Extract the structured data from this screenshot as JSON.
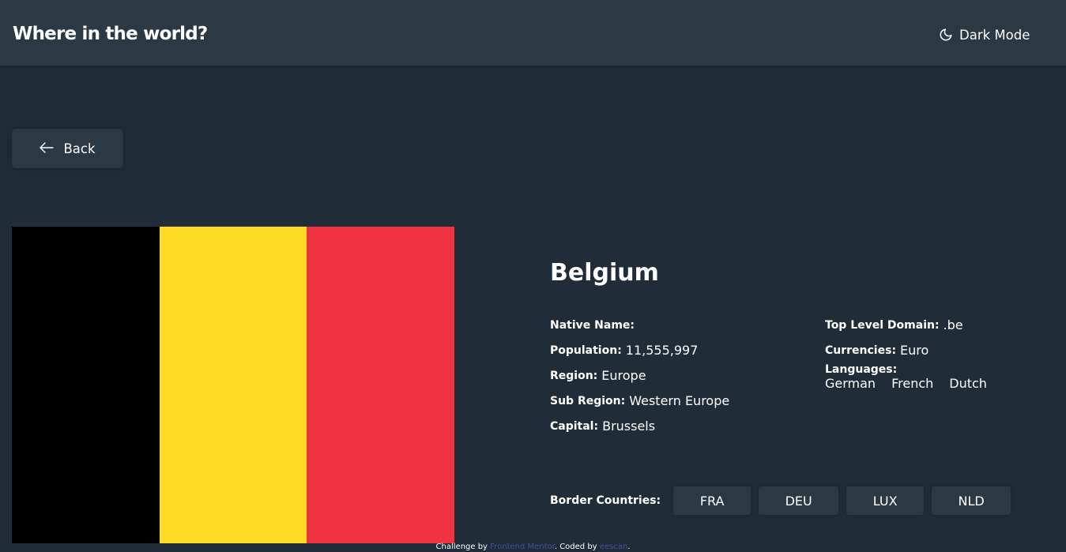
{
  "header": {
    "title": "Where in the world?",
    "theme_toggle_label": "Dark Mode",
    "theme_icon": "moon-icon"
  },
  "back_button": {
    "label": "Back",
    "icon": "arrow-left-icon"
  },
  "flag": {
    "country": "Belgium",
    "stripe_colors": [
      "#000000",
      "#fdda24",
      "#ef3340"
    ]
  },
  "country": {
    "name": "Belgium",
    "native_name_label": "Native Name:",
    "native_name_value": "",
    "population_label": "Population:",
    "population_value": "11,555,997",
    "region_label": "Region:",
    "region_value": "Europe",
    "sub_region_label": "Sub Region:",
    "sub_region_value": "Western Europe",
    "capital_label": "Capital:",
    "capital_value": "Brussels",
    "tld_label": "Top Level Domain:",
    "tld_value": ".be",
    "currencies_label": "Currencies:",
    "currencies_value": "Euro",
    "languages_label": "Languages:",
    "languages": [
      "German",
      "French",
      "Dutch"
    ]
  },
  "borders": {
    "label": "Border Countries:",
    "countries": [
      "FRA",
      "DEU",
      "LUX",
      "NLD"
    ]
  },
  "footer": {
    "prefix": "Challenge by",
    "link1": "Frontend Mentor",
    "middle": ". Coded by",
    "link2": "eescan",
    "suffix": "."
  },
  "colors": {
    "background": "#202c37",
    "elements": "#2b3945",
    "text": "#ffffff",
    "link": "#3e52a3"
  }
}
